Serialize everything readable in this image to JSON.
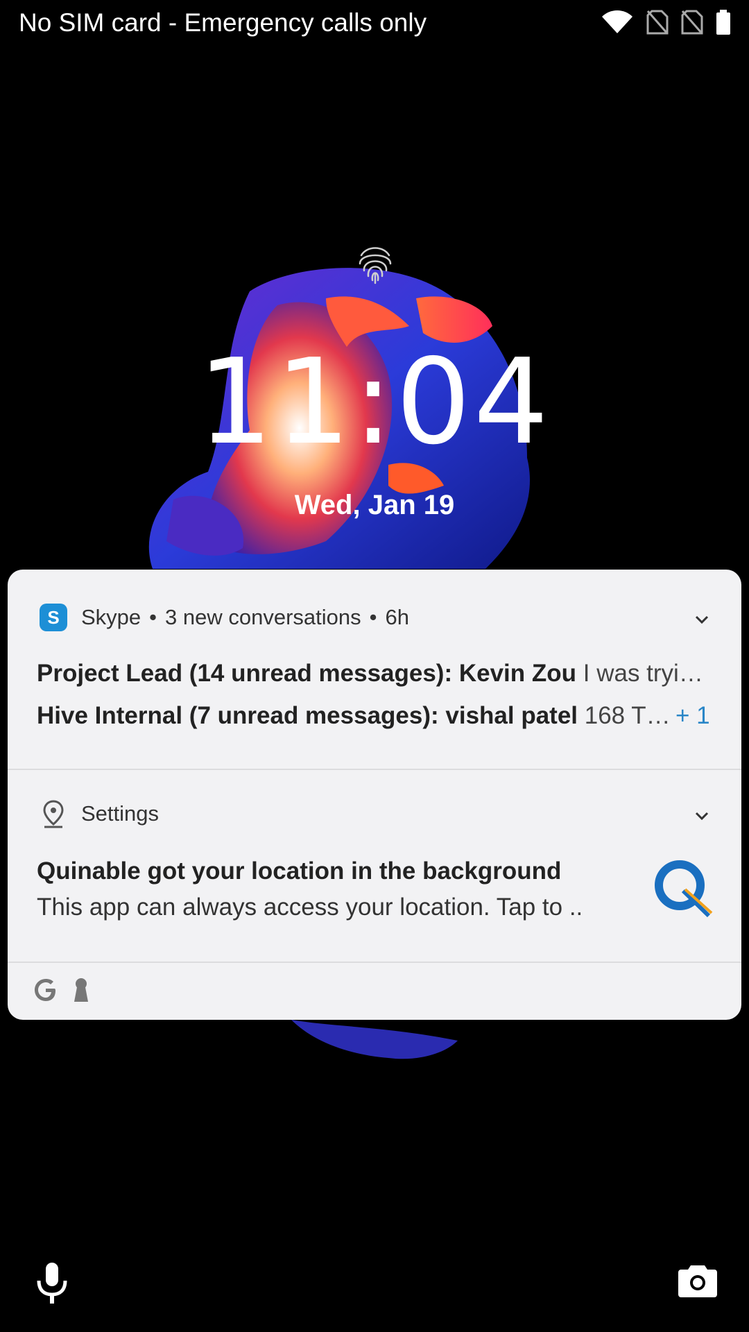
{
  "status_bar": {
    "carrier_text": "No SIM card - Emergency calls only",
    "icons": [
      "wifi-icon",
      "no-sim-icon",
      "no-sim-icon",
      "battery-icon"
    ]
  },
  "lockscreen": {
    "time": "11:04",
    "date": "Wed, Jan 19",
    "fingerprint_icon": "fingerprint-icon"
  },
  "notifications": {
    "skype": {
      "app_name": "Skype",
      "summary": "3 new conversations",
      "age": "6h",
      "line1_bold": "Project Lead (14 unread messages): Kevin Zou",
      "line1_rest": "I was tryi…",
      "line2_bold": "Hive Internal  (7 unread messages): vishal patel",
      "line2_rest": "168 T…",
      "more_count": "+ 1",
      "accent_color": "#2a86c7"
    },
    "settings": {
      "app_name": "Settings",
      "title": "Quinable got your location in the background",
      "body": "This app can always access your location. Tap to .."
    },
    "footer_icons": [
      "google-icon",
      "keyhole-icon"
    ]
  },
  "shortcuts": {
    "left": "mic-icon",
    "right": "camera-icon"
  }
}
